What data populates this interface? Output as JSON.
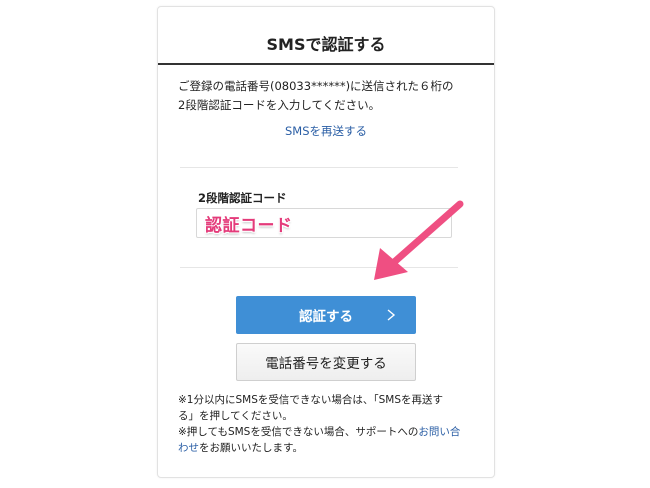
{
  "header": {
    "title": "SMSで認証する"
  },
  "description": {
    "line1": "ご登録の電話番号(08033******)に送信された６桁の",
    "line2": "2段階認証コードを入力してください。"
  },
  "resend_link": "SMSを再送する",
  "code_field": {
    "label": "2段階認証コード",
    "value": "認証コード"
  },
  "buttons": {
    "verify_label": "認証する",
    "change_phone_label": "電話番号を変更する"
  },
  "notes": {
    "line1_prefix": "※1分以内にSMSを受信できない場合は、「SMSを再送す",
    "line2": "る」を押してください。",
    "line3_prefix": "※押してもSMSを受信できない場合、サポートへの",
    "line3_link": "お問い合",
    "line4_link": "わせ",
    "line4_suffix": "をお願いいたします。"
  },
  "colors": {
    "primary_button": "#3f8fd6",
    "link": "#2a5ea5",
    "annotation_pink": "#e43b7a",
    "arrow": "#ef4f82"
  },
  "icons": {
    "button_chevron": "chevron-right-icon",
    "annotation_arrow": "arrow-icon"
  }
}
